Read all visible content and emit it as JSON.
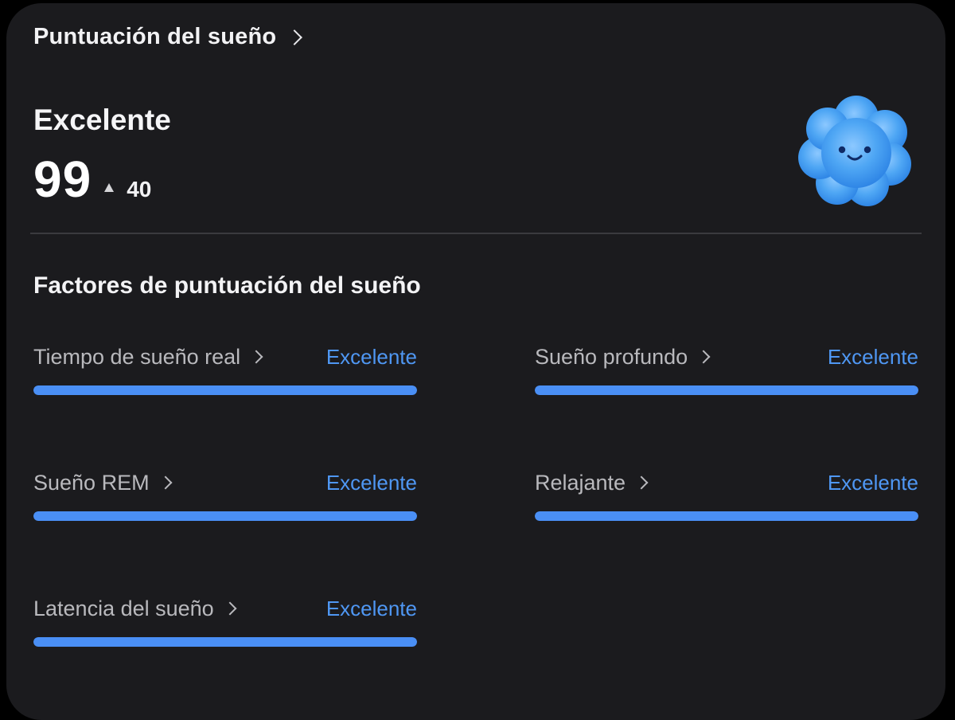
{
  "header": {
    "title": "Puntuación del sueño"
  },
  "score": {
    "status": "Excelente",
    "value": "99",
    "delta": "40",
    "delta_direction": "up"
  },
  "mascot": {
    "icon": "smiling-cloud-icon",
    "color": "#4ea6f4"
  },
  "factors": {
    "title": "Factores de puntuación del sueño",
    "items": [
      {
        "label": "Tiempo de sueño real",
        "rating": "Excelente",
        "level": 1.0
      },
      {
        "label": "Sueño profundo",
        "rating": "Excelente",
        "level": 1.0
      },
      {
        "label": "Sueño REM",
        "rating": "Excelente",
        "level": 1.0
      },
      {
        "label": "Relajante",
        "rating": "Excelente",
        "level": 1.0
      },
      {
        "label": "Latencia del sueño",
        "rating": "Excelente",
        "level": 1.0
      }
    ]
  },
  "colors": {
    "accent": "#4a8ff5",
    "background": "#1b1b1e",
    "rating_text": "#4f97f3"
  }
}
